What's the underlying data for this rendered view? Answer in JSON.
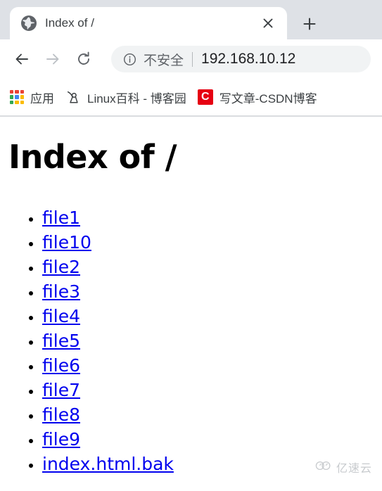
{
  "browser": {
    "tab": {
      "title": "Index of /",
      "favicon": "globe-icon",
      "close_label": "×"
    },
    "new_tab_label": "+",
    "toolbar": {
      "back_icon": "back-arrow-icon",
      "forward_icon": "forward-arrow-icon",
      "reload_icon": "reload-icon",
      "omnibox": {
        "info_icon": "info-circle-icon",
        "security_label": "不安全",
        "url": "192.168.10.12"
      }
    },
    "bookmarks": [
      {
        "label": "应用",
        "icon": "apps-grid-icon"
      },
      {
        "label": "Linux百科 - 博客园",
        "icon": "cnblogs-icon"
      },
      {
        "label": "写文章-CSDN博客",
        "icon": "csdn-icon",
        "icon_text": "C"
      }
    ]
  },
  "page": {
    "heading": "Index of /",
    "files": [
      "file1",
      "file10",
      "file2",
      "file3",
      "file4",
      "file5",
      "file6",
      "file7",
      "file8",
      "file9",
      "index.html.bak"
    ]
  },
  "watermark": {
    "text": "亿速云",
    "icon": "cloud-icon"
  },
  "colors": {
    "tabstrip_bg": "#dee1e6",
    "omnibox_bg": "#f1f3f4",
    "link": "#0000ee",
    "csdn_red": "#e60012",
    "icon_gray": "#5f6368",
    "icon_disabled": "#bdc1c6"
  }
}
